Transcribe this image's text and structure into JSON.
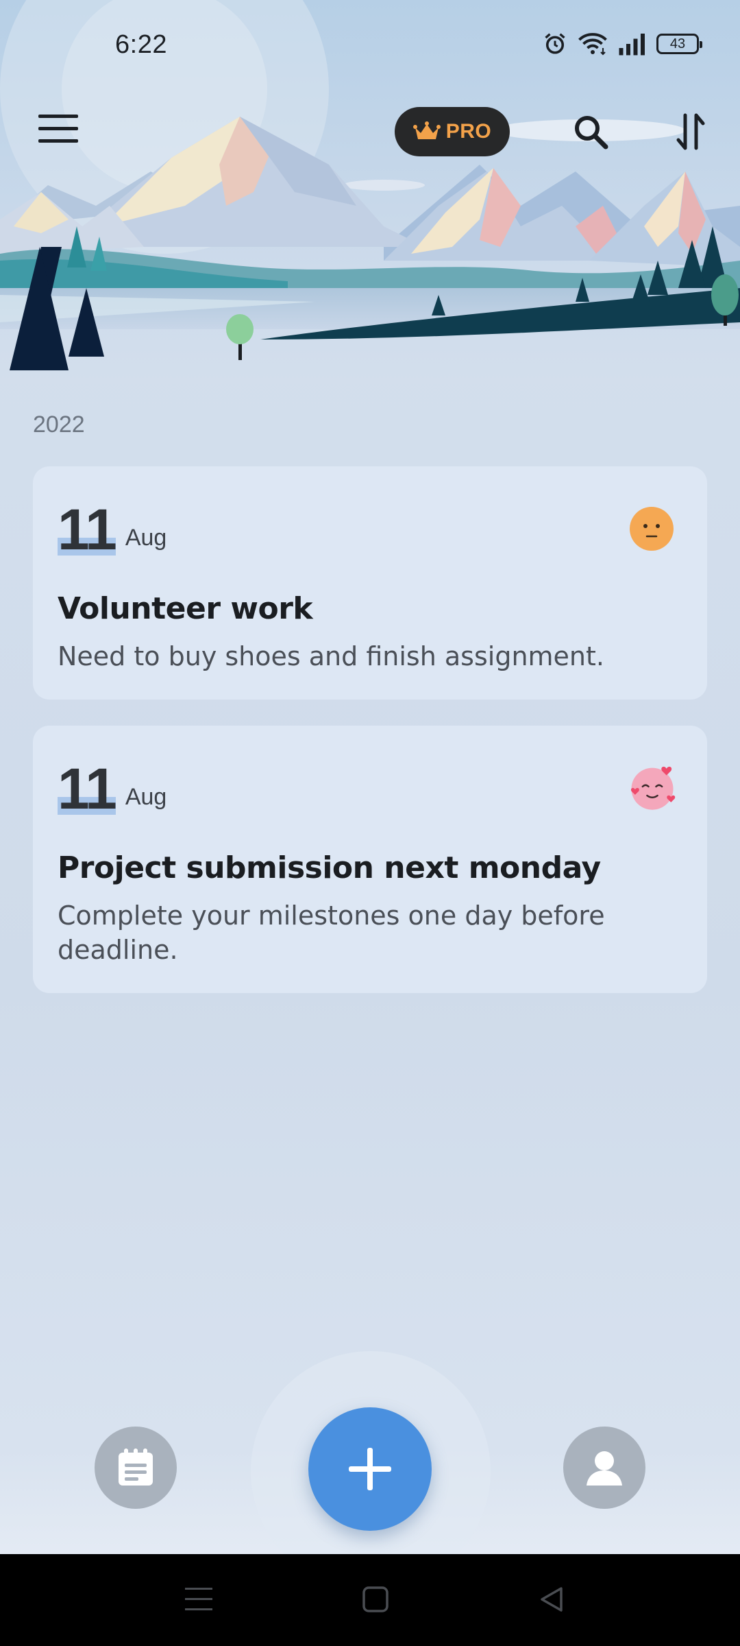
{
  "status_bar": {
    "time": "6:22",
    "battery_level": "43",
    "icons": [
      "alarm-icon",
      "wifi-icon",
      "signal-icon",
      "battery-icon"
    ]
  },
  "toolbar": {
    "menu_icon": "hamburger-menu-icon",
    "pro_label": "PRO",
    "pro_icon": "crown-icon",
    "search_icon": "search-icon",
    "sort_icon": "sort-arrows-icon"
  },
  "timeline": {
    "year": "2022",
    "entries": [
      {
        "day": "11",
        "month": "Aug",
        "mood": "neutral-face-icon",
        "title": "Volunteer work",
        "body": "Need to buy shoes and finish assignment."
      },
      {
        "day": "11",
        "month": "Aug",
        "mood": "in-love-face-icon",
        "title": "Project submission next monday",
        "body": "Complete your milestones one day before deadline."
      }
    ]
  },
  "bottom_nav": {
    "left_icon": "diary-notepad-icon",
    "center_icon": "plus-icon",
    "right_icon": "profile-icon"
  },
  "colors": {
    "accent": "#4a90df",
    "pro_text": "#f3a24a",
    "card_bg": "#dde7f4",
    "date_highlight": "#a9c6ea",
    "mood_neutral": "#f5a853",
    "mood_love": "#f4a7bb"
  }
}
